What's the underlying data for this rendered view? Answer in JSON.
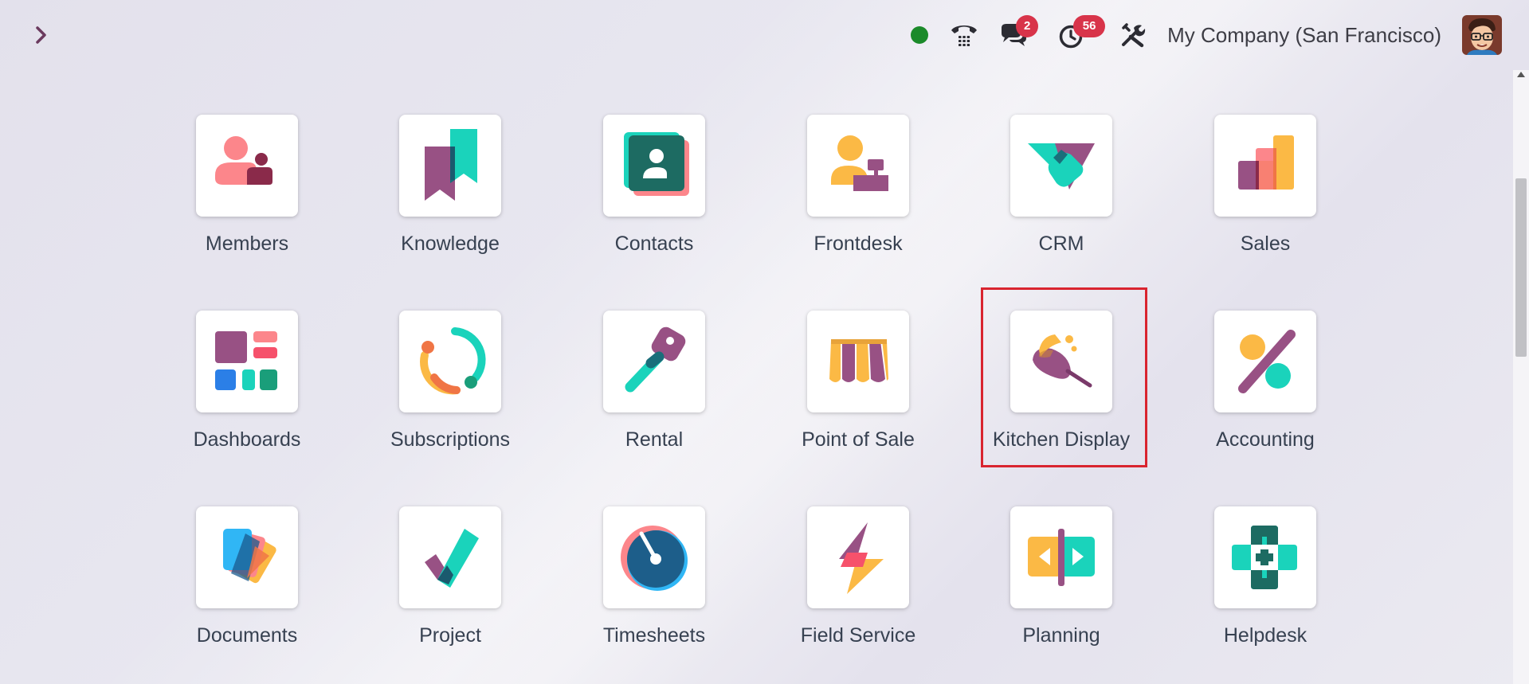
{
  "topbar": {
    "company": "My Company (San Francisco)",
    "messages_count": "2",
    "activities_count": "56",
    "presence_color": "#1b8a2a"
  },
  "icons": {
    "menu_toggle": "chevron-right-icon",
    "phone": "voip-phone-icon",
    "chat": "chat-bubbles-icon",
    "activity": "clock-icon",
    "tools": "debug-tools-icon"
  },
  "apps": [
    {
      "label": "Members"
    },
    {
      "label": "Knowledge"
    },
    {
      "label": "Contacts"
    },
    {
      "label": "Frontdesk"
    },
    {
      "label": "CRM"
    },
    {
      "label": "Sales"
    },
    {
      "label": "Dashboards"
    },
    {
      "label": "Subscriptions"
    },
    {
      "label": "Rental"
    },
    {
      "label": "Point of Sale"
    },
    {
      "label": "Kitchen Display"
    },
    {
      "label": "Accounting"
    },
    {
      "label": "Documents"
    },
    {
      "label": "Project"
    },
    {
      "label": "Timesheets"
    },
    {
      "label": "Field Service"
    },
    {
      "label": "Planning"
    },
    {
      "label": "Helpdesk"
    }
  ],
  "colors": {
    "highlight": "#d9242f",
    "badge": "#d8344a",
    "odoo_purple": "#985184",
    "teal": "#1ad3bb",
    "orange": "#fbb945",
    "coral": "#fc868b"
  }
}
